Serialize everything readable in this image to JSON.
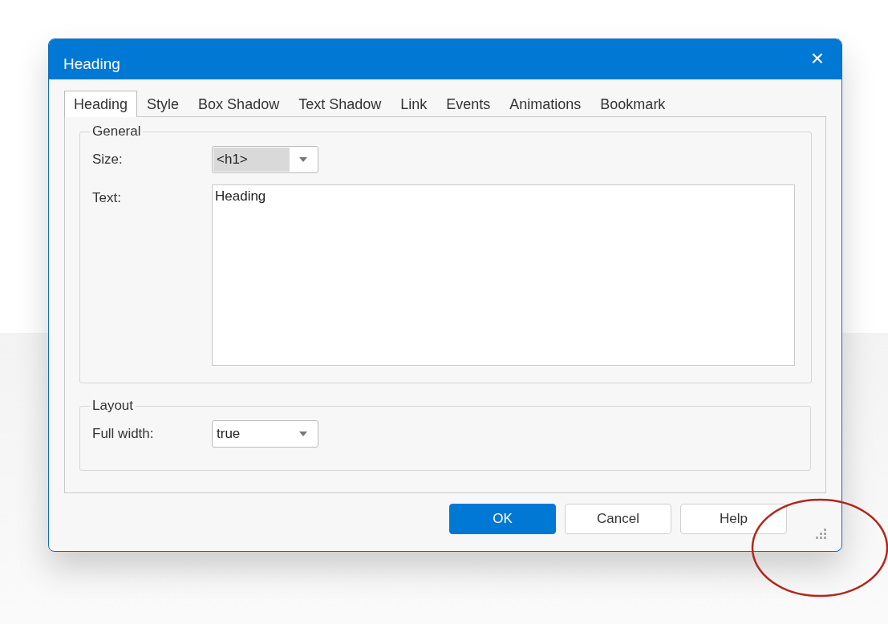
{
  "window": {
    "title": "Heading",
    "close": "×"
  },
  "tabs": [
    {
      "label": "Heading",
      "selected": true
    },
    {
      "label": "Style",
      "selected": false
    },
    {
      "label": "Box Shadow",
      "selected": false
    },
    {
      "label": "Text Shadow",
      "selected": false
    },
    {
      "label": "Link",
      "selected": false
    },
    {
      "label": "Events",
      "selected": false
    },
    {
      "label": "Animations",
      "selected": false
    },
    {
      "label": "Bookmark",
      "selected": false
    }
  ],
  "groups": [
    {
      "title": "General",
      "fields": [
        {
          "kind": "select",
          "label": "Size:",
          "value": "<h1>",
          "highlighted": true
        },
        {
          "kind": "textarea",
          "label": "Text:",
          "value": "Heading"
        }
      ]
    },
    {
      "title": "Layout",
      "fields": [
        {
          "kind": "select",
          "label": "Full width:",
          "value": "true",
          "highlighted": false
        }
      ]
    }
  ],
  "buttons": [
    {
      "label": "OK",
      "primary": true
    },
    {
      "label": "Cancel",
      "primary": false
    },
    {
      "label": "Help",
      "primary": false
    }
  ]
}
